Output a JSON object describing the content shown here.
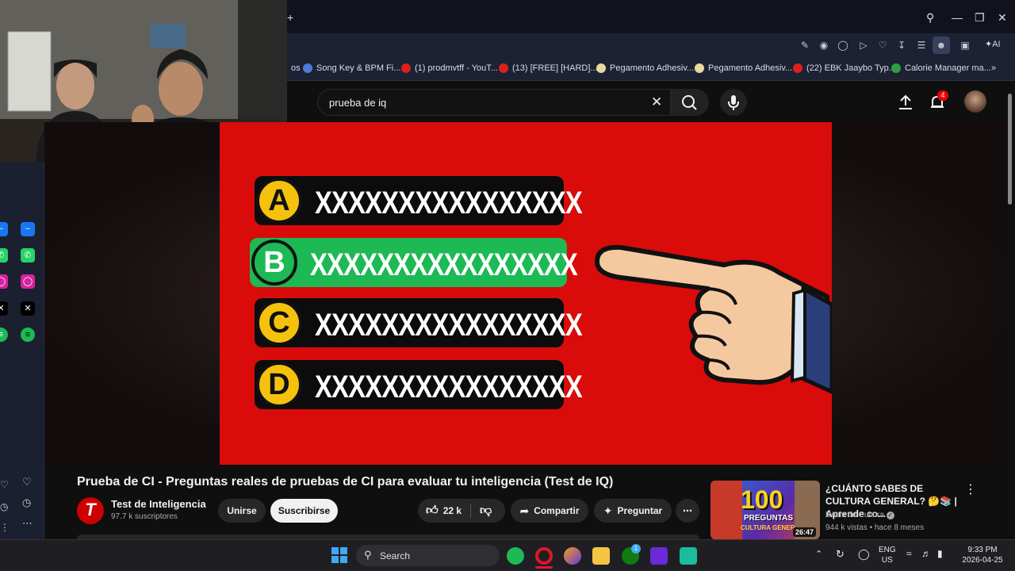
{
  "browser": {
    "bookmarks": [
      {
        "label": "os",
        "color": "#2b2b2b"
      },
      {
        "label": "Song Key & BPM Fi...",
        "color": "#4a7bd8"
      },
      {
        "label": "(1) prodmvtff - YouT...",
        "color": "#e01e1e"
      },
      {
        "label": "(13) [FREE] [HARD]...",
        "color": "#e01e1e"
      },
      {
        "label": "Pegamento Adhesiv...",
        "color": "#e8d9a0"
      },
      {
        "label": "Pegamento Adhesiv...",
        "color": "#e8d9a0"
      },
      {
        "label": "(22) EBK Jaaybo Typ...",
        "color": "#e01e1e"
      },
      {
        "label": "Calorie Manager ma...",
        "color": "#2ea043"
      }
    ],
    "ai_label": "AI"
  },
  "youtube": {
    "search_value": "prueba de iq",
    "notification_count": "4",
    "video": {
      "options": [
        {
          "letter": "A",
          "text": "XXXXXXXXXXXXXXXX",
          "highlight": false
        },
        {
          "letter": "B",
          "text": "XXXXXXXXXXXXXXXX",
          "highlight": true
        },
        {
          "letter": "C",
          "text": "XXXXXXXXXXXXXXXX",
          "highlight": false
        },
        {
          "letter": "D",
          "text": "XXXXXXXXXXXXXXXX",
          "highlight": false
        }
      ],
      "title": "Prueba de CI - Preguntas reales de pruebas de CI para evaluar tu inteligencia (Test de IQ)"
    },
    "channel": {
      "logo": "T",
      "name": "Test de Inteligencia",
      "subscribers": "97.7 k suscriptores",
      "join_label": "Unirse",
      "subscribe_label": "Suscribirse"
    },
    "actions": {
      "likes": "22 k",
      "share_label": "Compartir",
      "ask_label": "Preguntar"
    },
    "recommended": {
      "thumb_big": "100",
      "thumb_sub1": "PREGUNTAS",
      "thumb_sub2": "CULTURA GENERAL",
      "duration": "26:47",
      "title": "¿CUÁNTO SABES DE CULTURA GENERAL? 🤔📚 | Aprende co...",
      "channel": "Dosis de Cultura",
      "meta": "944 k vistas • hace 8 meses"
    }
  },
  "taskbar": {
    "search_placeholder": "Search",
    "lang_top": "ENG",
    "lang_bottom": "US",
    "time": "9:33 PM",
    "date": "2026-04-25",
    "xbox_badge": "1"
  }
}
